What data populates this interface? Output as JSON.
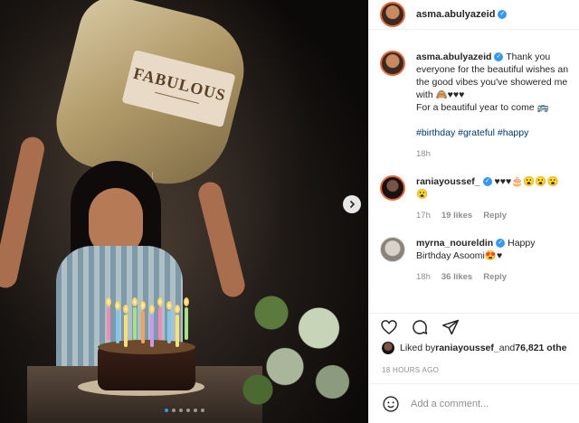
{
  "post": {
    "username": "asma.abulyazeid",
    "verified": true,
    "photo": {
      "balloon_text": "FABULOUS",
      "carousel_total": 6,
      "carousel_active": 1
    }
  },
  "caption": {
    "username": "asma.abulyazeid",
    "lines": [
      "Thank you",
      "everyone for the beautiful wishes an",
      "the good vibes you've showered me",
      "with 🙈♥♥♥",
      "For a beautiful year to come 🚌"
    ],
    "tags": "#birthday #grateful #happy",
    "age": "18h"
  },
  "comments": [
    {
      "username": "raniayoussef_",
      "verified": true,
      "line1": "♥♥♥🎂😮😮😮",
      "line2": "😮",
      "age": "17h",
      "likes": "19 likes",
      "reply": "Reply"
    },
    {
      "username": "myrna_noureldin",
      "verified": true,
      "line1": "Happy",
      "line2": "Birthday Asoomi😍♥",
      "age": "18h",
      "likes": "36 likes",
      "reply": "Reply"
    }
  ],
  "likes": {
    "prefix": "Liked by ",
    "user": "raniayoussef_",
    "middle": " and ",
    "others": "76,821 othe"
  },
  "timestamp": "18 HOURS AGO",
  "add_comment": {
    "placeholder": "Add a comment..."
  },
  "icons": {
    "like": "heart-icon",
    "comment": "comment-icon",
    "share": "share-icon",
    "emoji": "emoji-icon",
    "next": "chevron-right-icon"
  },
  "colors": {
    "accent": "#3897f0",
    "hashtag": "#00376b",
    "muted": "#8e8e8e",
    "text": "#262626"
  }
}
